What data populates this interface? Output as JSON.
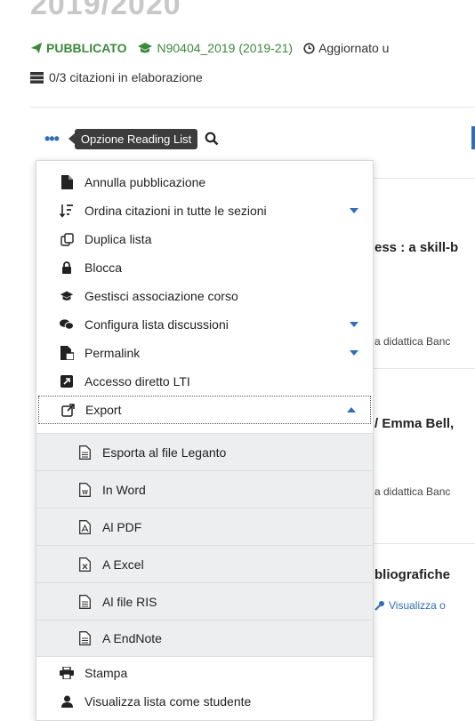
{
  "header": {
    "title_fragment": "2019/2020",
    "status": "PUBBLICATO",
    "course_code": "N90404_2019 (2019-21)",
    "updated": "Aggiornato u",
    "citations": "0/3 citazioni in elaborazione"
  },
  "toolbar": {
    "tooltip": "Opzione Reading List"
  },
  "background_items": [
    {
      "title": "ess : a skill-b",
      "sub": "a didattica Banc"
    },
    {
      "title": "/ Emma Bell,",
      "sub": "a didattica Banc"
    },
    {
      "title": "bliografiche",
      "link": "Visualizza o"
    }
  ],
  "menu": {
    "items": [
      {
        "label": "Annulla pubblicazione",
        "icon": "file-icon"
      },
      {
        "label": "Ordina citazioni in tutte le sezioni",
        "icon": "sort-icon",
        "caret": "down"
      },
      {
        "label": "Duplica lista",
        "icon": "copy-icon"
      },
      {
        "label": "Blocca",
        "icon": "lock-icon"
      },
      {
        "label": "Gestisci associazione corso",
        "icon": "graduation-cap-icon"
      },
      {
        "label": "Configura lista discussioni",
        "icon": "comments-icon",
        "caret": "down"
      },
      {
        "label": "Permalink",
        "icon": "permalink-icon",
        "caret": "down"
      },
      {
        "label": "Accesso diretto LTI",
        "icon": "external-square-icon"
      },
      {
        "label": "Export",
        "icon": "external-link-icon",
        "caret": "up"
      }
    ],
    "export_items": [
      {
        "label": "Esporta al file Leganto",
        "icon": "file-text-icon"
      },
      {
        "label": "In Word",
        "icon": "file-word-icon"
      },
      {
        "label": "Al PDF",
        "icon": "file-pdf-icon"
      },
      {
        "label": "A Excel",
        "icon": "file-excel-icon"
      },
      {
        "label": "Al file RIS",
        "icon": "file-text-icon"
      },
      {
        "label": "A EndNote",
        "icon": "file-text-icon"
      }
    ],
    "bottom_items": [
      {
        "label": "Stampa",
        "icon": "print-icon"
      },
      {
        "label": "Visualizza lista come studente",
        "icon": "user-icon"
      }
    ]
  },
  "colors": {
    "accent_blue": "#2f6fb5",
    "published_green": "#3a8a3a",
    "submenu_bg": "#eceef0",
    "tooltip_bg": "#3c3c3c"
  }
}
